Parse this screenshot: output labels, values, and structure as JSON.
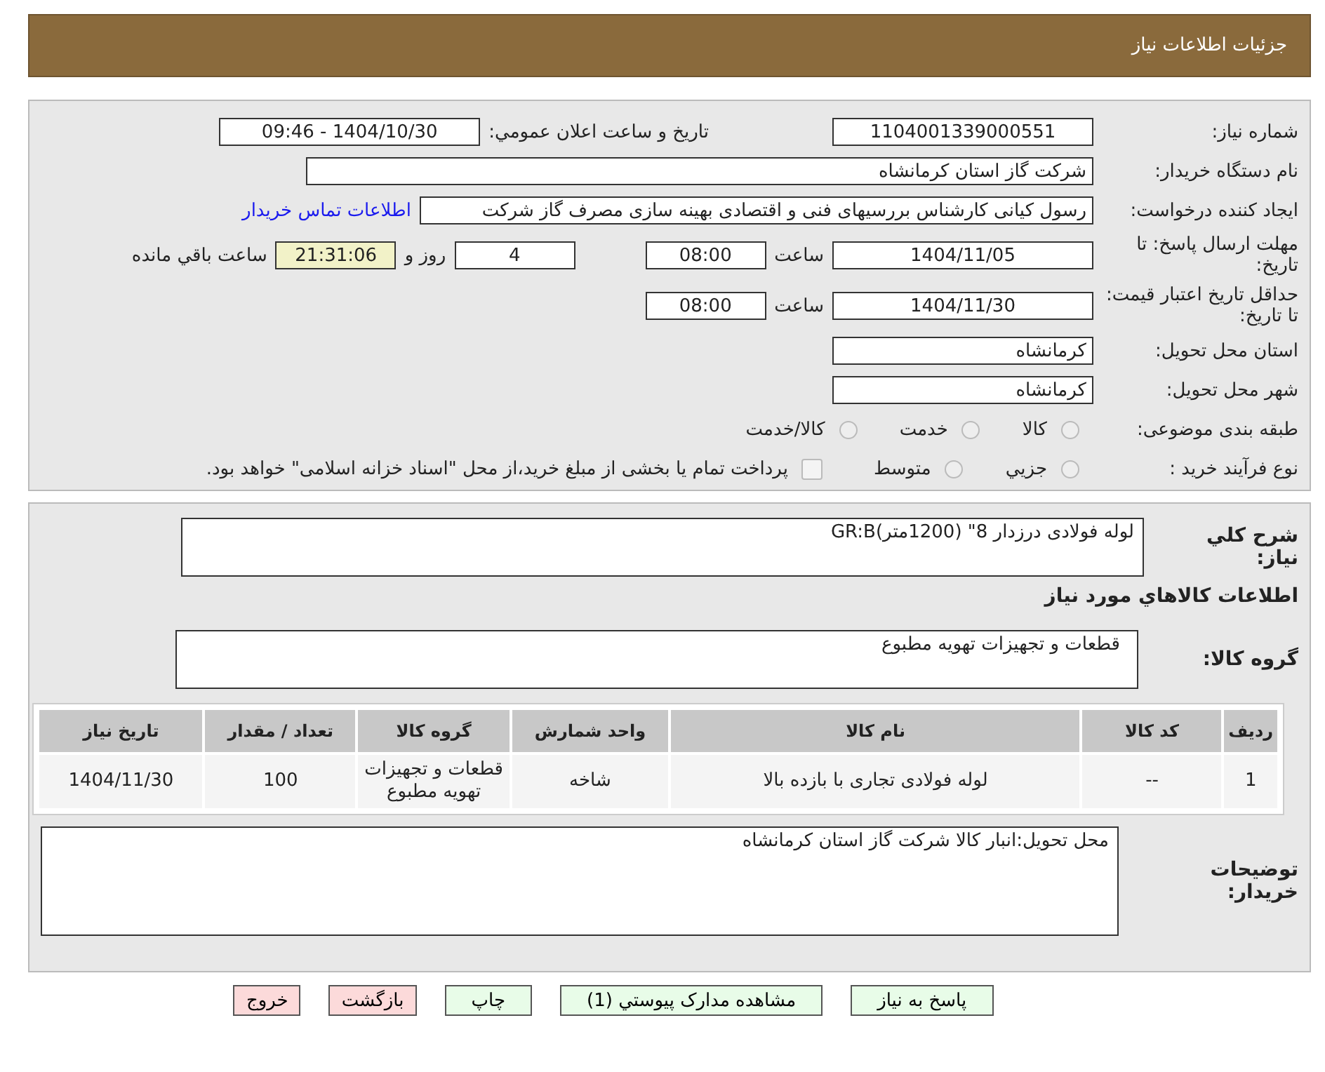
{
  "header": {
    "title": "جزئیات اطلاعات نیاز"
  },
  "details": {
    "need_number": {
      "label": "شماره نیاز:",
      "value": "1104001339000551"
    },
    "announce": {
      "label": "تاریخ و ساعت اعلان عمومي:",
      "value": "1404/10/30 - 09:46"
    },
    "buyer": {
      "label": "نام دستگاه خریدار:",
      "value": "شرکت گاز استان کرمانشاه"
    },
    "creator": {
      "label": "ایجاد کننده درخواست:",
      "value": "رسول کیانی کارشناس بررسیهای فنی و اقتصادی بهینه سازی مصرف گاز شرکت",
      "link": "اطلاعات تماس خریدار"
    },
    "deadline": {
      "label": "مهلت ارسال پاسخ: تا تاریخ:",
      "date": "1404/11/05",
      "time_label": "ساعت",
      "time": "08:00",
      "days": "4",
      "days_label": "روز و",
      "remaining": "21:31:06",
      "remaining_label": "ساعت باقي مانده"
    },
    "validity": {
      "label": "حداقل تاریخ اعتبار قیمت: تا تاریخ:",
      "date": "1404/11/30",
      "time_label": "ساعت",
      "time": "08:00"
    },
    "province": {
      "label": "استان محل تحویل:",
      "value": "کرمانشاه"
    },
    "city": {
      "label": "شهر محل تحویل:",
      "value": "کرمانشاه"
    },
    "category": {
      "label": "طبقه بندی موضوعی:",
      "options": [
        {
          "label": "کالا",
          "selected": false
        },
        {
          "label": "خدمت",
          "selected": false
        },
        {
          "label": "کالا/خدمت",
          "selected": false
        }
      ]
    },
    "process": {
      "label": "نوع فرآیند خرید :",
      "options": [
        {
          "label": "جزيي",
          "selected": false
        },
        {
          "label": "متوسط",
          "selected": false
        }
      ],
      "payment": {
        "checked": false,
        "text": "پرداخت تمام یا بخشی از مبلغ خرید،از محل \"اسناد خزانه اسلامی\" خواهد بود."
      }
    }
  },
  "items": {
    "summary": {
      "label": "شرح کلي نیاز:",
      "value": "لوله فولادی درزدار 8\" (1200متر)GR:B"
    },
    "section_title": "اطلاعات کالاهاي مورد نیاز",
    "group": {
      "label": "گروه کالا:",
      "value": "قطعات و تجهیزات تهویه مطبوع"
    },
    "table": {
      "columns": [
        "ردیف",
        "کد کالا",
        "نام کالا",
        "واحد شمارش",
        "گروه کالا",
        "تعداد / مقدار",
        "تاریخ نیاز"
      ],
      "rows": [
        [
          "1",
          "--",
          "لوله فولادی تجاری با بازده بالا",
          "شاخه",
          "قطعات و تجهیزات تهویه مطبوع",
          "100",
          "1404/11/30"
        ]
      ]
    },
    "notes": {
      "label": "توضیحات خریدار:",
      "value": "محل تحویل:انبار کالا شرکت گاز استان کرمانشاه"
    }
  },
  "buttons": [
    {
      "label": "پاسخ به نیاز",
      "kind": "action"
    },
    {
      "label": "مشاهده مدارک پیوستي (1)",
      "kind": "action"
    },
    {
      "label": "چاپ",
      "kind": "action"
    },
    {
      "label": "بازگشت",
      "kind": "danger"
    },
    {
      "label": "خروج",
      "kind": "danger"
    }
  ]
}
